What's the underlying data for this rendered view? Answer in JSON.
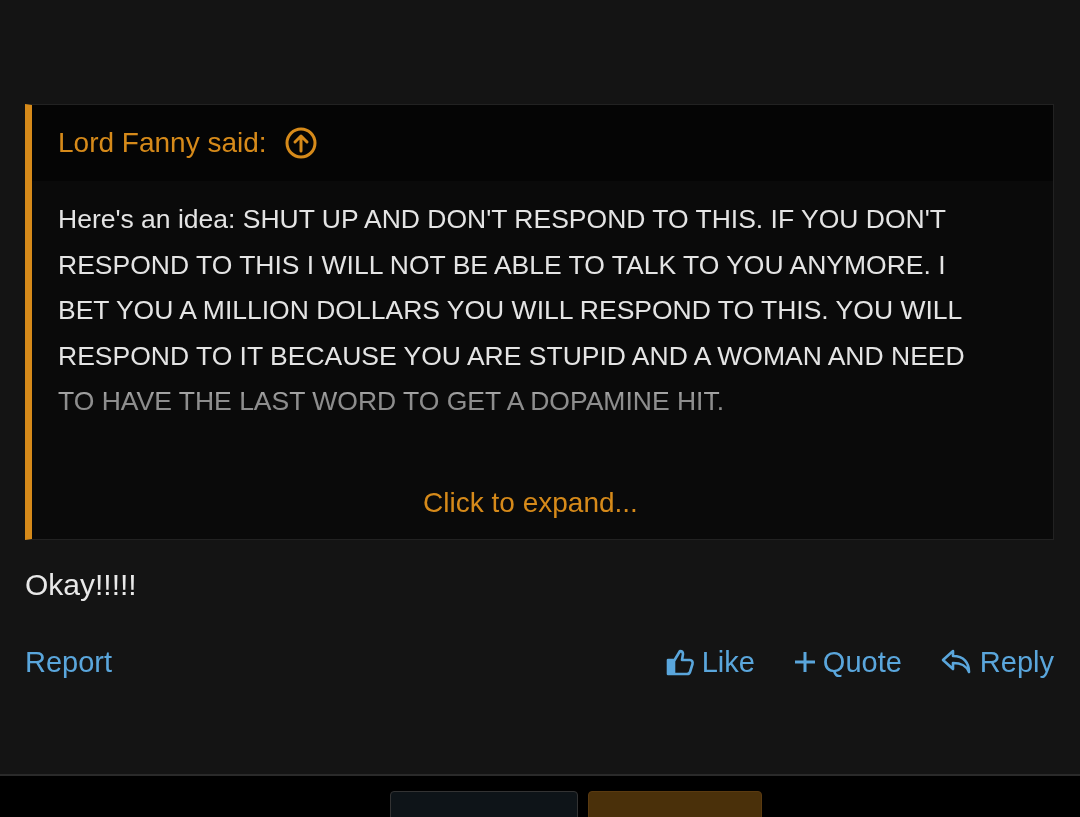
{
  "quote": {
    "author": "Lord Fanny said:",
    "body": "Here's an idea: SHUT UP AND DON'T RESPOND TO THIS. IF YOU DON'T RESPOND TO THIS I WILL NOT BE ABLE TO TALK TO YOU ANYMORE. I BET YOU A MILLION DOLLARS YOU WILL RESPOND TO THIS. YOU WILL RESPOND TO IT BECAUSE YOU ARE STUPID AND A WOMAN AND NEED TO HAVE THE LAST WORD TO GET A DOPAMINE HIT.",
    "expand": "Click to expand..."
  },
  "message": "Okay!!!!!",
  "actions": {
    "report": "Report",
    "buttons": [
      {
        "kind": "like",
        "label": "Like"
      },
      {
        "kind": "quote",
        "label": "Quote"
      },
      {
        "kind": "reply",
        "label": "Reply"
      }
    ]
  }
}
